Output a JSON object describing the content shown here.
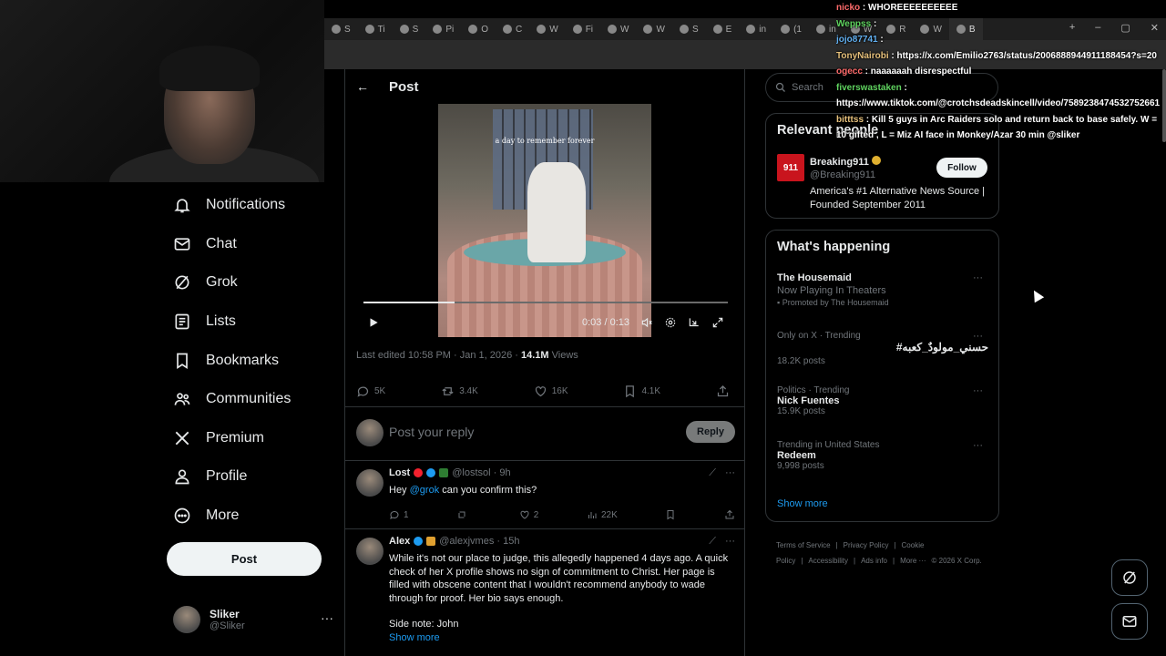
{
  "browser": {
    "tabs": [
      "S",
      "Ti",
      "S",
      "Pi",
      "O",
      "C",
      "W",
      "Fi",
      "W",
      "W",
      "S",
      "E",
      "in",
      "(1",
      "in",
      "W",
      "R",
      "W",
      "B"
    ],
    "new_tab": "+",
    "controls": {
      "minimize": "–",
      "maximize": "▢",
      "close": "✕"
    }
  },
  "nav": {
    "items": [
      {
        "label": "Notifications",
        "icon": "bell-icon"
      },
      {
        "label": "Chat",
        "icon": "mail-icon"
      },
      {
        "label": "Grok",
        "icon": "grok-icon"
      },
      {
        "label": "Lists",
        "icon": "list-icon"
      },
      {
        "label": "Bookmarks",
        "icon": "bookmark-icon"
      },
      {
        "label": "Communities",
        "icon": "people-icon"
      },
      {
        "label": "Premium",
        "icon": "x-logo-icon"
      },
      {
        "label": "Profile",
        "icon": "person-icon"
      },
      {
        "label": "More",
        "icon": "more-circle-icon"
      }
    ],
    "post_button": "Post",
    "account": {
      "name": "Sliker",
      "handle": "@Sliker",
      "menu": "···"
    }
  },
  "post": {
    "header_title": "Post",
    "video": {
      "caption": "a day to remember forever",
      "time": "0:03 / 0:13",
      "progress": 0.25
    },
    "edited_prefix": "Last edited 10:58 PM · Jan 1, 2026 · ",
    "views_count": "14.1M",
    "views_label": " Views",
    "actions": {
      "replies": "5K",
      "reposts": "3.4K",
      "likes": "16K",
      "bookmarks": "4.1K"
    },
    "reply_placeholder": "Post your reply",
    "reply_button": "Reply"
  },
  "replies": [
    {
      "name": "Lost",
      "handle": "@lostsol · 9h",
      "text_prefix": "Hey ",
      "mention": "@grok",
      "text_suffix": " can you confirm this?",
      "actions": {
        "replies": "1",
        "reposts": "",
        "likes": "2",
        "views": "22K"
      }
    },
    {
      "name": "Alex",
      "handle": "@alexjvmes · 15h",
      "text": "While it's not our place to judge, this allegedly happened 4 days ago. A quick check of her X profile shows no sign of commitment to Christ. Her page is filled with obscene content that I wouldn't recommend anybody to wade through for proof. Her bio says enough.",
      "text2": "Side note: John",
      "show_more": "Show more"
    }
  ],
  "sidebar": {
    "search_placeholder": "Search",
    "relevant": {
      "title": "Relevant people",
      "name": "Breaking911",
      "handle": "@Breaking911",
      "logo_text": "911",
      "bio": "America's #1 Alternative News Source | Founded September 2011",
      "follow": "Follow"
    },
    "happening": {
      "title": "What's happening",
      "trends": [
        {
          "meta": "",
          "name": "The Housemaid",
          "sub": "Now Playing In Theaters",
          "promo": "Promoted by The Housemaid"
        },
        {
          "meta": "Only on X · Trending",
          "name": "#حسني_مولودٌ_كعبه",
          "sub": "18.2K posts",
          "promo": ""
        },
        {
          "meta": "Politics · Trending",
          "name": "Nick Fuentes",
          "sub": "15.9K posts",
          "promo": ""
        },
        {
          "meta": "Trending in United States",
          "name": "Redeem",
          "sub": "9,998 posts",
          "promo": ""
        }
      ],
      "show_more": "Show more"
    },
    "footer": [
      "Terms of Service",
      "|",
      "Privacy Policy",
      "|",
      "Cookie Policy",
      "|",
      "Accessibility",
      "|",
      "Ads info",
      "|",
      "More ···",
      "© 2026 X Corp."
    ]
  },
  "chat": [
    {
      "user": "nicko",
      "msg": "WHOREEEEEEEEEE"
    },
    {
      "user": "Weppss",
      "msg": ""
    },
    {
      "user": "jojo87741",
      "msg": ""
    },
    {
      "user": "TonyNairobi",
      "msg": "https://x.com/Emilio2763/status/2006888944911188454?s=20"
    },
    {
      "user": "ogecc",
      "msg": "naaaaaah disrespectful"
    },
    {
      "user": "fiverswastaken",
      "msg": ""
    },
    {
      "user": "",
      "msg": "https://www.tiktok.com/@crotchsdeadskincell/video/7589238474532752661"
    },
    {
      "user": "bitttss",
      "msg": "Kill 5 guys in Arc Raiders solo and return back to base safely. W ="
    },
    {
      "user": "",
      "msg": "10 gifted , L = Miz AI face in Monkey/Azar 30 min @sliker"
    }
  ],
  "colors": {
    "accent": "#1d9bf0",
    "border": "#2f3336",
    "muted": "#71767b"
  }
}
